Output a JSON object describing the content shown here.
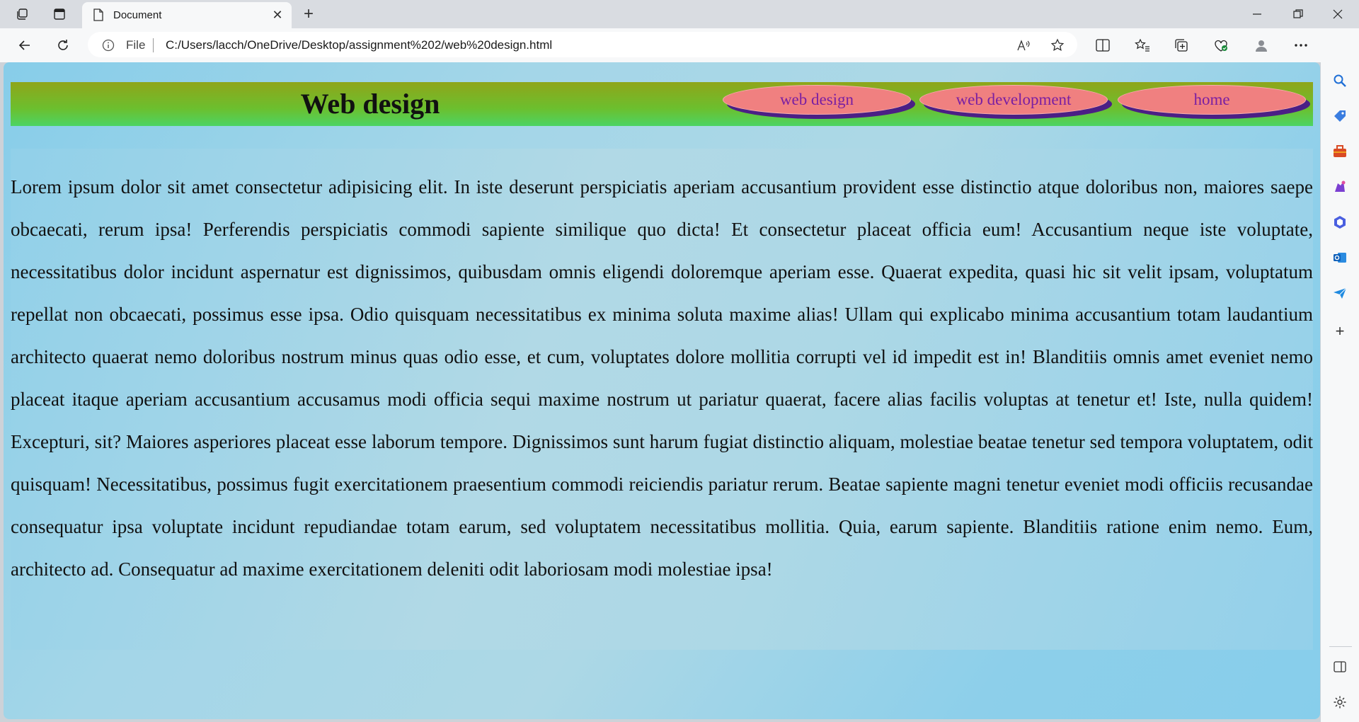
{
  "browser": {
    "tab_title": "Document",
    "address": {
      "protocol_label": "File",
      "url": "C:/Users/lacch/OneDrive/Desktop/assignment%202/web%20design.html"
    }
  },
  "page": {
    "header_title": "Web design",
    "nav": [
      "web design",
      "web development",
      "home"
    ],
    "paragraph": "Lorem ipsum dolor sit amet consectetur adipisicing elit. In iste deserunt perspiciatis aperiam accusantium provident esse distinctio atque doloribus non, maiores saepe obcaecati, rerum ipsa! Perferendis perspiciatis commodi sapiente similique quo dicta! Et consectetur placeat officia eum! Accusantium neque iste voluptate, necessitatibus dolor incidunt aspernatur est dignissimos, quibusdam omnis eligendi doloremque aperiam esse. Quaerat expedita, quasi hic sit velit ipsam, voluptatum repellat non obcaecati, possimus esse ipsa. Odio quisquam necessitatibus ex minima soluta maxime alias! Ullam qui explicabo minima accusantium totam laudantium architecto quaerat nemo doloribus nostrum minus quas odio esse, et cum, voluptates dolore mollitia corrupti vel id impedit est in! Blanditiis omnis amet eveniet nemo placeat itaque aperiam accusantium accusamus modi officia sequi maxime nostrum ut pariatur quaerat, facere alias facilis voluptas at tenetur et! Iste, nulla quidem! Excepturi, sit? Maiores asperiores placeat esse laborum tempore. Dignissimos sunt harum fugiat distinctio aliquam, molestiae beatae tenetur sed tempora voluptatem, odit quisquam! Necessitatibus, possimus fugit exercitationem praesentium commodi reiciendis pariatur rerum. Beatae sapiente magni tenetur eveniet modi officiis recusandae consequatur ipsa voluptate incidunt repudiandae totam earum, sed voluptatem necessitatibus mollitia. Quia, earum sapiente. Blanditiis ratione enim nemo. Eum, architecto ad. Consequatur ad maxime exercitationem deleniti odit laboriosam modi molestiae ipsa!"
  },
  "colors": {
    "page_background": "#87ceeb",
    "header_gradient_top": "#8fa51a",
    "header_gradient_bottom": "#4cd463",
    "nav_pill": "#f08080",
    "nav_shadow": "#4b1f85",
    "nav_text": "#7a1fa2"
  },
  "icons": {
    "titlebar": [
      "workspaces-icon",
      "vertical-tabs-icon"
    ],
    "toolbar": [
      "back-icon",
      "refresh-icon",
      "info-icon",
      "read-aloud-icon",
      "favorite-star-icon",
      "split-screen-icon",
      "favorites-icon",
      "collections-icon",
      "browser-essentials-icon",
      "profile-icon",
      "more-icon",
      "copilot-icon"
    ],
    "sidebar": [
      "search-icon",
      "shopping-icon",
      "tools-icon",
      "games-icon",
      "office-icon",
      "outlook-icon",
      "drop-icon",
      "add-icon",
      "sidebar-toggle-icon",
      "settings-icon"
    ]
  }
}
